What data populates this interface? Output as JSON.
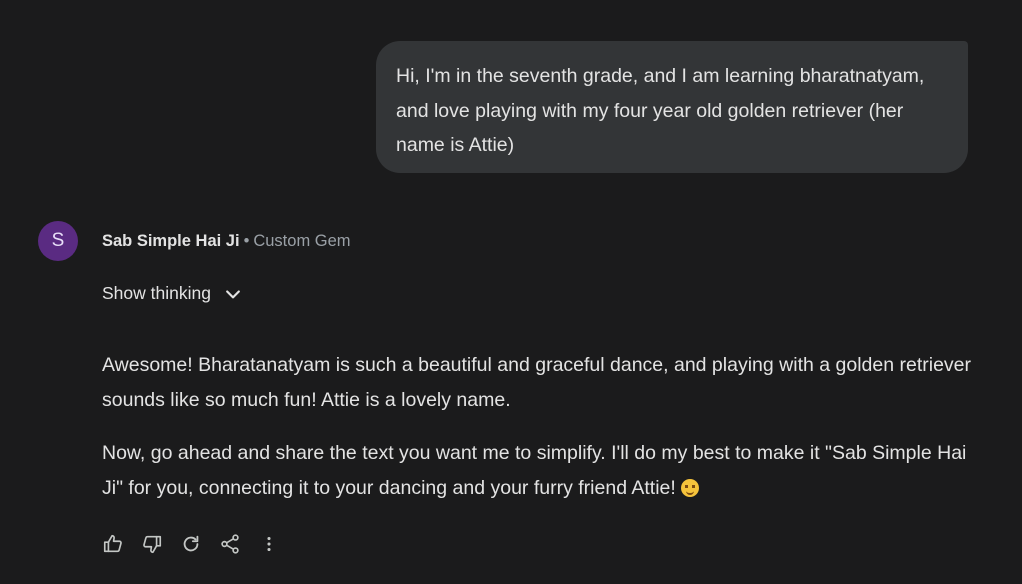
{
  "user_message": {
    "text": "Hi, I'm in the seventh grade, and I am learning bharatnatyam, and love playing with my four year old golden retriever (her name is Attie)"
  },
  "assistant": {
    "avatar_letter": "S",
    "name": "Sab Simple Hai Ji",
    "separator": "•",
    "type": "Custom Gem",
    "show_thinking_label": "Show thinking",
    "paragraphs": [
      "Awesome! Bharatanatyam is such a beautiful and graceful dance, and playing with a golden retriever sounds like so much fun! Attie is a lovely name.",
      "Now, go ahead and share the text you want me to simplify. I'll do my best to make it \"Sab Simple Hai Ji\" for you, connecting it to your dancing and your furry friend Attie!"
    ],
    "trailing_emoji": "😊"
  },
  "actions": [
    {
      "name": "thumbs-up-icon",
      "label": "Good response"
    },
    {
      "name": "thumbs-down-icon",
      "label": "Bad response"
    },
    {
      "name": "redo-icon",
      "label": "Redo"
    },
    {
      "name": "share-icon",
      "label": "Share"
    },
    {
      "name": "more-vert-icon",
      "label": "More"
    }
  ],
  "colors": {
    "background": "#1b1b1c",
    "bubble": "#333537",
    "avatar": "#5a2b82",
    "text": "#e3e3e3",
    "muted": "#9aa0a6"
  }
}
